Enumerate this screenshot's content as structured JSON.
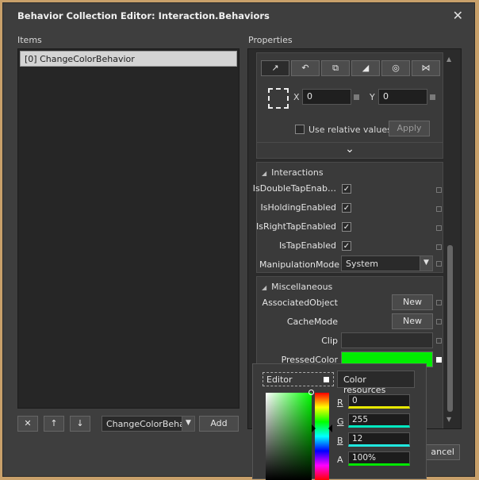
{
  "window": {
    "title": "Behavior Collection Editor: Interaction.Behaviors",
    "close_glyph": "✕"
  },
  "left": {
    "items_label": "Items",
    "items": [
      "[0] ChangeColorBehavior"
    ],
    "remove_glyph": "✕",
    "up_glyph": "↑",
    "down_glyph": "↓",
    "behavior_combo": "ChangeColorBeha",
    "add_label": "Add"
  },
  "right": {
    "properties_label": "Properties",
    "transform": {
      "tabs": [
        "↗",
        "↶",
        "⧉",
        "◢",
        "◎",
        "⋈"
      ],
      "x_label": "X",
      "x_value": "0",
      "y_label": "Y",
      "y_value": "0",
      "relative_label": "Use relative values",
      "apply_label": "Apply",
      "expand_glyph": "⌄"
    },
    "interactions": {
      "header": "Interactions",
      "rows": [
        {
          "label": "IsDoubleTapEnab…",
          "checked": true
        },
        {
          "label": "IsHoldingEnabled",
          "checked": true
        },
        {
          "label": "IsRightTapEnabled",
          "checked": true
        },
        {
          "label": "IsTapEnabled",
          "checked": true
        }
      ],
      "manipulation_label": "ManipulationMode",
      "manipulation_value": "System"
    },
    "misc": {
      "header": "Miscellaneous",
      "associated_label": "AssociatedObject",
      "associated_btn": "New",
      "cache_label": "CacheMode",
      "cache_btn": "New",
      "clip_label": "Clip",
      "pressed_label": "PressedColor",
      "pressed_color": "#00ee00"
    }
  },
  "color_editor": {
    "editor_tab": "Editor",
    "resources_tab": "Color resources",
    "r_label": "R",
    "r_value": "0",
    "g_label": "G",
    "g_value": "255",
    "b_label": "B",
    "b_value": "12",
    "a_label": "A",
    "a_value": "100%"
  },
  "footer": {
    "cancel_label": "ancel"
  }
}
